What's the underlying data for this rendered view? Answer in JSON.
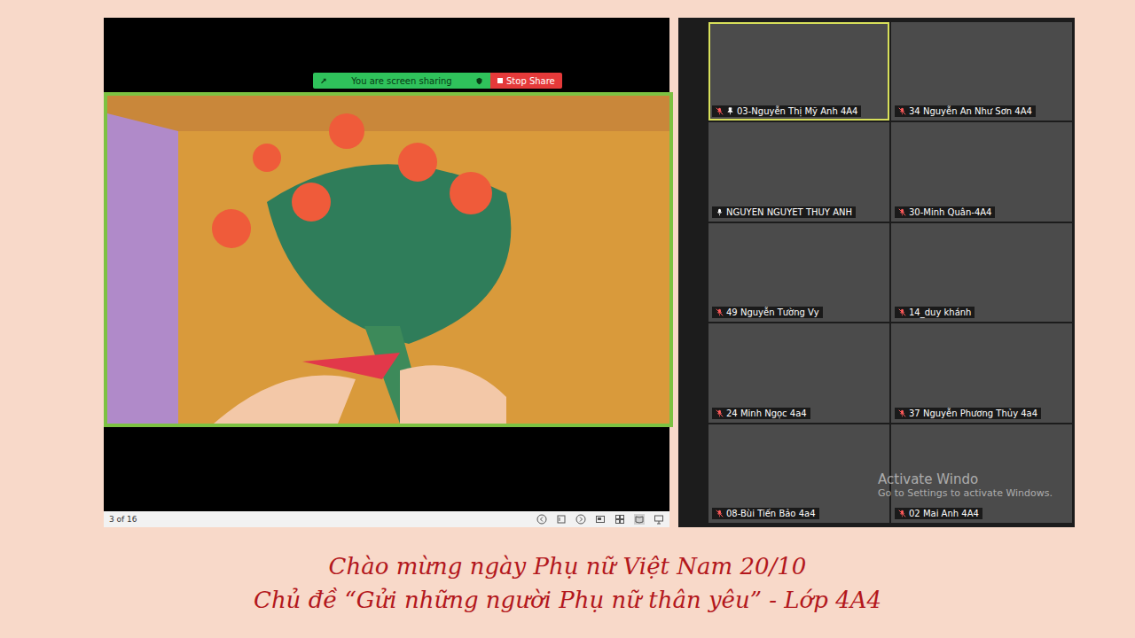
{
  "share_toolbar": {
    "status": "You are screen sharing",
    "stop_button": "Stop Share"
  },
  "slideshow_bar": {
    "counter": "3 of 16"
  },
  "participants": [
    {
      "name": "03-Nguyễn Thị Mỹ Anh 4A4",
      "muted": true,
      "pinned": true,
      "active_speaker": true
    },
    {
      "name": "34 Nguyễn An Như Sơn 4A4",
      "muted": true,
      "pinned": false,
      "active_speaker": false
    },
    {
      "name": "NGUYEN NGUYET THUY ANH",
      "muted": false,
      "pinned": false,
      "active_speaker": false
    },
    {
      "name": "30-Minh Quân-4A4",
      "muted": true,
      "pinned": false,
      "active_speaker": false
    },
    {
      "name": "49 Nguyễn Tường Vy",
      "muted": true,
      "pinned": false,
      "active_speaker": false
    },
    {
      "name": "14_duy khánh",
      "muted": true,
      "pinned": false,
      "active_speaker": false
    },
    {
      "name": "24 Minh Ngọc 4a4",
      "muted": true,
      "pinned": false,
      "active_speaker": false
    },
    {
      "name": "37 Nguyễn Phương Thủy 4a4",
      "muted": true,
      "pinned": false,
      "active_speaker": false
    },
    {
      "name": "08-Bùi Tiến Bảo 4a4",
      "muted": true,
      "pinned": false,
      "active_speaker": false
    },
    {
      "name": "02 Mai Anh 4A4",
      "muted": true,
      "pinned": false,
      "active_speaker": false
    }
  ],
  "watermark": {
    "line1": "Activate Windo",
    "line2": "Go to Settings to activate Windows."
  },
  "caption": {
    "line1": "Chào mừng ngày Phụ nữ Việt Nam 20/10",
    "line2": "Chủ đề “Gửi những người Phụ nữ thân yêu” - Lớp 4A4"
  }
}
